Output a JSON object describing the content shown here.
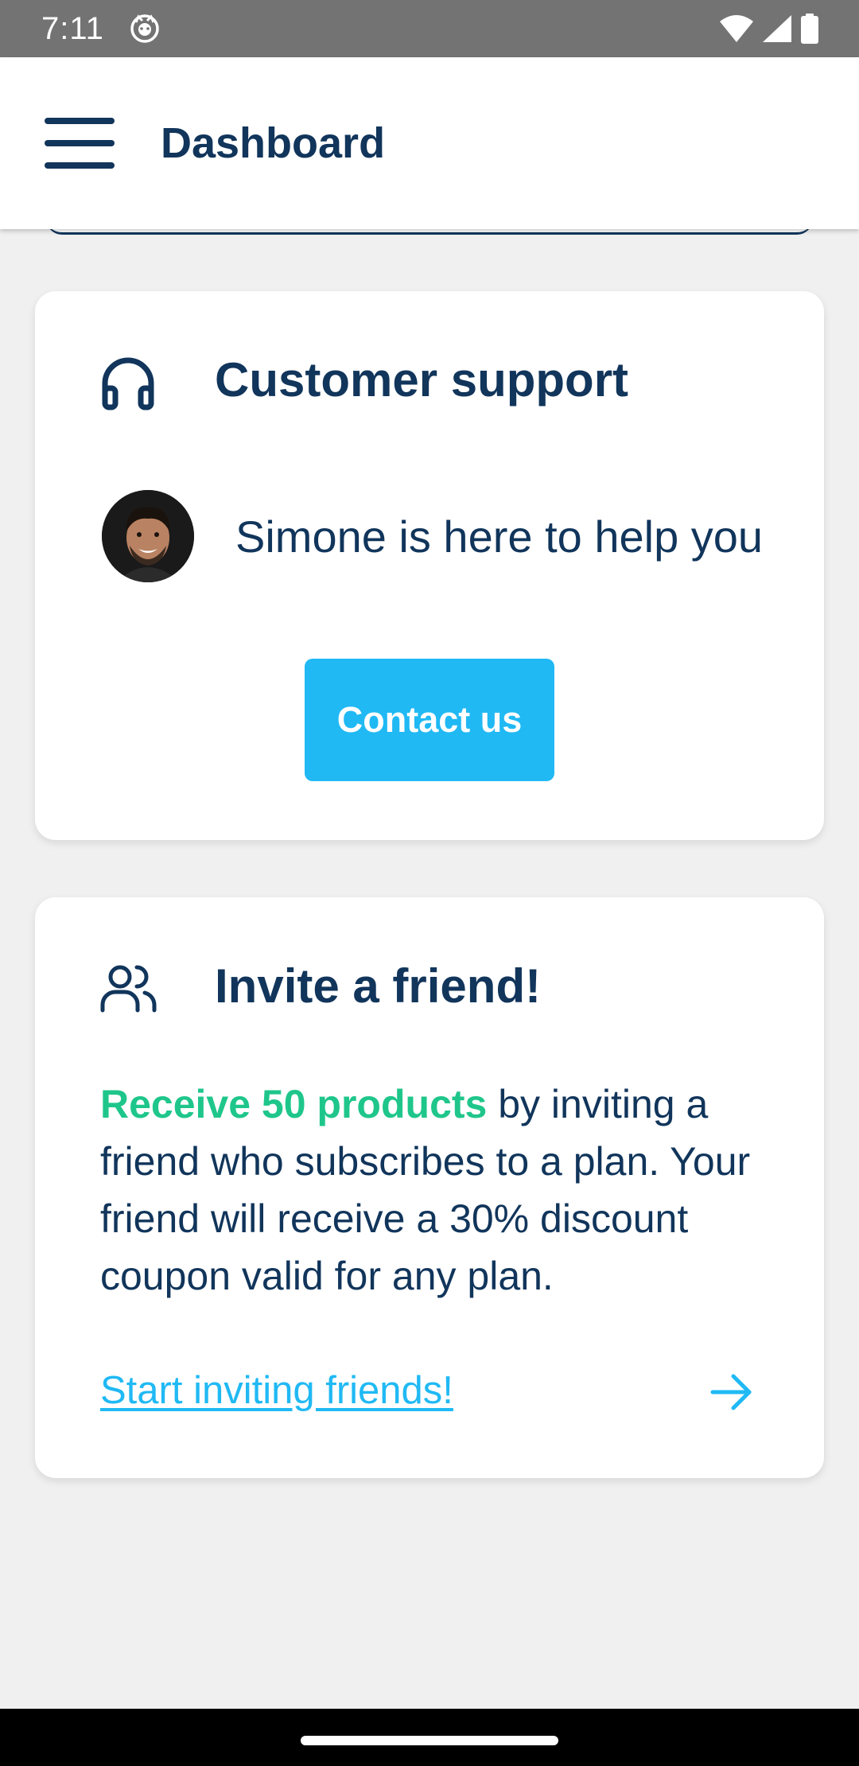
{
  "status_bar": {
    "time": "7:11",
    "icons": [
      "cat-icon",
      "wifi-icon",
      "signal-icon",
      "battery-icon"
    ]
  },
  "app_bar": {
    "title": "Dashboard",
    "menu_icon": "hamburger-menu-icon"
  },
  "support_card": {
    "icon": "headphones-icon",
    "title": "Customer support",
    "helper_text": "Simone is here to help you",
    "avatar": "agent-avatar",
    "button_label": "Contact us"
  },
  "invite_card": {
    "icon": "users-icon",
    "title": "Invite a friend!",
    "highlight": "Receive 50 products",
    "body": " by inviting a friend who subscribes to a plan. Your friend will receive a 30% discount coupon valid for any plan.",
    "link_label": "Start inviting friends!",
    "link_icon": "arrow-right-icon"
  },
  "colors": {
    "primary_text": "#11355b",
    "accent_blue": "#20b9f4",
    "accent_green": "#1fc68b",
    "background": "#f0f0f0",
    "status_bar": "#737373"
  }
}
